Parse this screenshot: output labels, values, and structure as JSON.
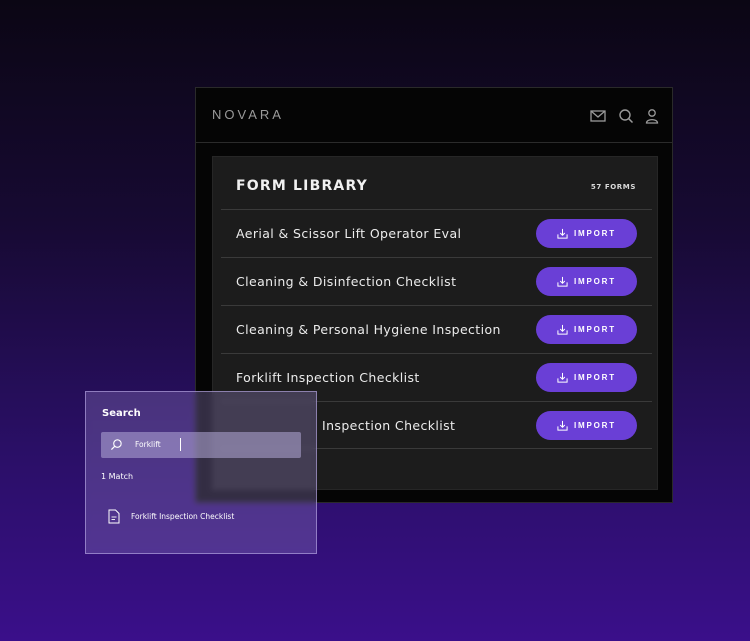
{
  "header": {
    "brand": "NOVARA",
    "icons": [
      "mail-icon",
      "search-icon",
      "user-icon"
    ]
  },
  "library": {
    "title": "FORM LIBRARY",
    "count": "57 FORMS",
    "import_label": "IMPORT",
    "forms": [
      {
        "name": "Aerial & Scissor Lift Operator Eval"
      },
      {
        "name": "Cleaning & Disinfection Checklist"
      },
      {
        "name": "Cleaning & Personal Hygiene Inspection"
      },
      {
        "name": "Forklift Inspection Checklist"
      },
      {
        "name": "Inspection Checklist"
      }
    ]
  },
  "search": {
    "heading": "Search",
    "value": "Forklift",
    "match_count": "1 Match",
    "results": [
      {
        "label": "Forklift Inspection Checklist"
      }
    ]
  },
  "colors": {
    "accent": "#6a3fd6",
    "panel": "#1c1c1c",
    "window": "#050505"
  }
}
